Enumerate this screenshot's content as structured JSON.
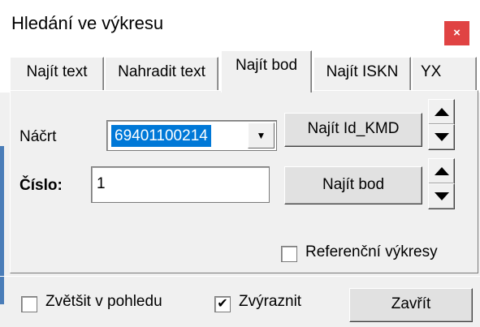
{
  "window": {
    "title": "Hledání ve výkresu",
    "close_glyph": "×",
    "close_icon": "close-icon"
  },
  "tabs": [
    {
      "label": "Najít text",
      "active": false
    },
    {
      "label": "Nahradit text",
      "active": false
    },
    {
      "label": "Najít bod",
      "active": true
    },
    {
      "label": "Najít ISKN",
      "active": false
    },
    {
      "label": "YX",
      "active": false
    }
  ],
  "form": {
    "nacrt_label": "Náčrt",
    "nacrt_value": "69401100214",
    "combo_arrow": "▼",
    "cislo_label": "Číslo:",
    "cislo_value": "1",
    "najit_id_kmd_label": "Najít Id_KMD",
    "najit_bod_label": "Najít bod",
    "referencni_label": "Referenční výkresy",
    "referencni_checked": false
  },
  "footer": {
    "zvetsit_label": "Zvětšit v pohledu",
    "zvetsit_checked": false,
    "zvyraznit_label": "Zvýraznit",
    "zvyraznit_checked": true,
    "check_glyph": "✔",
    "zavrit_label": "Zavřít"
  },
  "colors": {
    "close_bg": "#e04343",
    "selection_bg": "#0078d7",
    "window_bg": "#f0f0f0"
  }
}
